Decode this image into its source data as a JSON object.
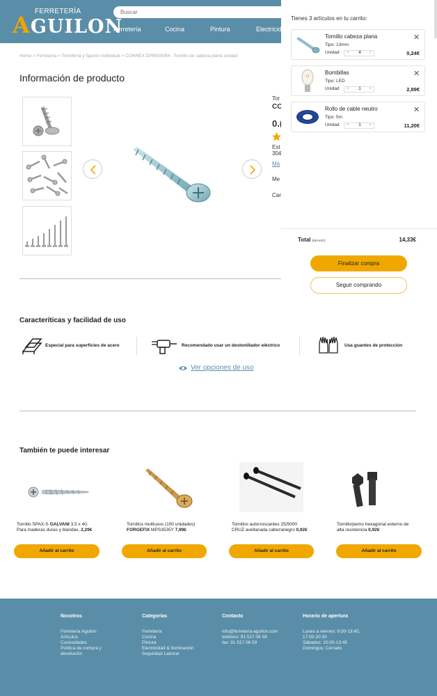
{
  "header": {
    "logo_top": "FERRETERÍA",
    "logo_initial": "A",
    "logo_rest": "GUILON",
    "search_placeholder": "Buscar",
    "nav": [
      "Ferretería",
      "Cocina",
      "Pintura",
      "Electricid"
    ]
  },
  "breadcrumb": "Home > Ferretería > Tornillería y fijación individual > CONNEX DP8500084 - Tornillo de cabeza plana unidad",
  "product": {
    "heading": "Información de producto",
    "cut_lines": [
      "Tor",
      "CC",
      "0.(",
      "Est",
      "304",
      "Má",
      "Me",
      "Car"
    ]
  },
  "features": {
    "heading": "Caracteríticas y facilidad de uso",
    "items": [
      {
        "icon": "steel-surface-icon",
        "label": "Especial para superficies de acero"
      },
      {
        "icon": "electric-screwdriver-icon",
        "label": "Recomendado usar un destonillador eléctrico"
      },
      {
        "icon": "gloves-icon",
        "label": "Usa guantes de protección"
      }
    ],
    "link": "Ver opciones de uso"
  },
  "recommendations": {
    "heading": "También te puede interesar",
    "button_label": "Añadir al carrito",
    "items": [
      {
        "line1": "Tornillo SPAX-S ",
        "bold1": "GALVANI",
        "line1b": " 3,5 x 40.",
        "line2": "Para maderas duras y blandas, ",
        "price": "2,29€"
      },
      {
        "line1": "Tornillos multiusos (100 unidades)",
        "bold2": "FORGEFIX",
        "line2": " MPS3535Y  ",
        "price": "7,99€"
      },
      {
        "line1": "Tornillos autorroscantes 25/5000",
        "line2": "CRUZ avellanada cabezanegro ",
        "price": "0,92€"
      },
      {
        "line1": "Tornillo/perno hexagonal externo de",
        "line2": "alta resistencia ",
        "price": "0,92€"
      }
    ]
  },
  "footer": {
    "columns": [
      {
        "heading": "Nosotros",
        "links": [
          "Ferretería Aguilon",
          "Artículos",
          "Curiosidades",
          "Política de compra y",
          "devolución"
        ]
      },
      {
        "heading": "Categorías",
        "links": [
          "Ferretería",
          "Cocina",
          "Pintura",
          "Electricidad & Iluminación",
          "Seguridad Laboral"
        ]
      },
      {
        "heading": "Contacto",
        "links": [
          "info@ferreteria-aguilon.com",
          "teléfono: 91 517 06 59",
          "fax: 91 517 06 59"
        ]
      },
      {
        "heading": "Horario de apertura",
        "links": [
          "Lunes a viernes: 9:30-13:45,",
          "17:00-20:30",
          "Sábados: 10:00-13:45",
          "Domingos: Cerrado"
        ]
      }
    ]
  },
  "cart": {
    "title": "Tienes 3 artículos en tu carrito:",
    "unit_label": "Unidad",
    "items": [
      {
        "name": "Tornillo cabeza plana",
        "type": "Tipo: 13mm",
        "qty": "4",
        "price": "0,24€"
      },
      {
        "name": "Bombillas",
        "type": "Tipo: LED",
        "qty": "1",
        "price": "2,89€"
      },
      {
        "name": "Rollo de cable neutro",
        "type": "Tipo: 5m",
        "qty": "1",
        "price": "11,20€"
      }
    ],
    "total_label": "Total",
    "total_note": "(IVA incl.)",
    "total_value": "14,33€",
    "checkout": "Finalizar compra",
    "continue": "Seguir comprando"
  },
  "colors": {
    "brand_blue": "#5a8ea8",
    "accent_orange": "#f0a800"
  }
}
